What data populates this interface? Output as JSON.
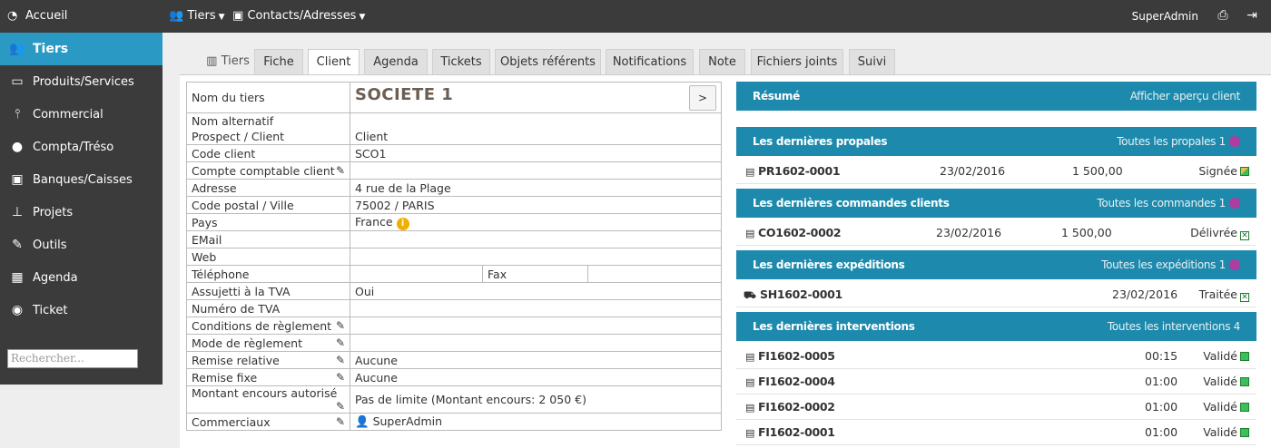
{
  "topbar": {
    "home": "Accueil",
    "menu1": "Tiers",
    "menu2": "Contacts/Adresses",
    "user": "SuperAdmin"
  },
  "sidebar": {
    "items": [
      {
        "label": "Tiers",
        "icon": "users-icon"
      },
      {
        "label": "Produits/Services",
        "icon": "box-icon"
      },
      {
        "label": "Commercial",
        "icon": "tie-icon"
      },
      {
        "label": "Compta/Tréso",
        "icon": "piggy-bank-icon"
      },
      {
        "label": "Banques/Caisses",
        "icon": "safe-icon"
      },
      {
        "label": "Projets",
        "icon": "sitemap-icon"
      },
      {
        "label": "Outils",
        "icon": "wrench-icon"
      },
      {
        "label": "Agenda",
        "icon": "calendar-icon"
      },
      {
        "label": "Ticket",
        "icon": "ticket-icon"
      }
    ],
    "search_placeholder": "Rechercher..."
  },
  "tabs": [
    "Tiers",
    "Fiche",
    "Client",
    "Agenda",
    "Tickets",
    "Objets référents",
    "Notifications",
    "Note",
    "Fichiers joints",
    "Suivi"
  ],
  "fiche": {
    "nom_label": "Nom du tiers",
    "nom_value": "SOCIETE 1",
    "nav": ">",
    "alt_label": "Nom alternatif",
    "prospect_label": "Prospect / Client",
    "prospect_value": "Client",
    "code_label": "Code client",
    "code_value": "SCO1",
    "compte_label": "Compte comptable client",
    "adresse_label": "Adresse",
    "adresse_value": "4 rue de la Plage",
    "cp_label": "Code postal / Ville",
    "cp_value": "75002 / PARIS",
    "pays_label": "Pays",
    "pays_value": "France",
    "email_label": "EMail",
    "web_label": "Web",
    "tel_label": "Téléphone",
    "fax_label": "Fax",
    "tva_label": "Assujetti à la TVA",
    "tva_value": "Oui",
    "numtva_label": "Numéro de TVA",
    "cond_label": "Conditions de règlement",
    "mode_label": "Mode de règlement",
    "remrel_label": "Remise relative",
    "remrel_value": "Aucune",
    "remfix_label": "Remise fixe",
    "remfix_value": "Aucune",
    "encours_label": "Montant encours autorisé",
    "encours_value": "Pas de limite (Montant encours: 2 050 €)",
    "comm_label": "Commerciaux",
    "comm_value": "SuperAdmin"
  },
  "resume": {
    "title": "Résumé",
    "link": "Afficher aperçu client"
  },
  "propales": {
    "title": "Les dernières propales",
    "link": "Toutes les propales",
    "count": "1",
    "rows": [
      {
        "ref": "PR1602-0001",
        "date": "23/02/2016",
        "amount": "1 500,00",
        "status": "Signée"
      }
    ]
  },
  "commandes": {
    "title": "Les dernières commandes clients",
    "link": "Toutes les commandes",
    "count": "1",
    "rows": [
      {
        "ref": "CO1602-0002",
        "date": "23/02/2016",
        "amount": "1 500,00",
        "status": "Délivrée"
      }
    ]
  },
  "expeditions": {
    "title": "Les dernières expéditions",
    "link": "Toutes les expéditions",
    "count": "1",
    "rows": [
      {
        "ref": "SH1602-0001",
        "date": "23/02/2016",
        "status": "Traitée"
      }
    ]
  },
  "interventions": {
    "title": "Les dernières interventions",
    "link": "Toutes les interventions",
    "count": "4",
    "rows": [
      {
        "ref": "FI1602-0005",
        "duration": "00:15",
        "status": "Validé"
      },
      {
        "ref": "FI1602-0004",
        "duration": "01:00",
        "status": "Validé"
      },
      {
        "ref": "FI1602-0002",
        "duration": "01:00",
        "status": "Validé"
      },
      {
        "ref": "FI1602-0001",
        "duration": "01:00",
        "status": "Validé"
      }
    ]
  }
}
